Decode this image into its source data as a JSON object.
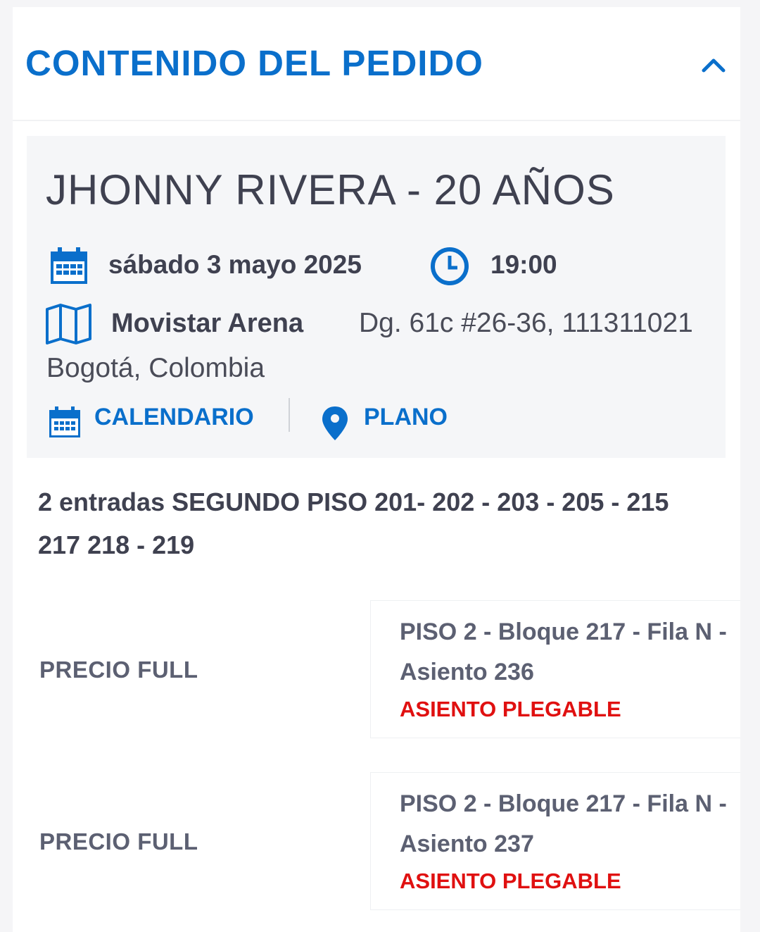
{
  "order": {
    "title": "CONTENIDO DEL PEDIDO"
  },
  "event": {
    "title": "JHONNY RIVERA - 20 AÑOS",
    "date": "sábado 3 mayo 2025",
    "time": "19:00",
    "venue_name": "Movistar Arena",
    "venue_address": "Dg. 61c #26-36, 111311021",
    "venue_city": "Bogotá, Colombia",
    "calendar_label": "CALENDARIO",
    "map_label": "PLANO"
  },
  "tickets": {
    "summary": "2 entradas SEGUNDO PISO 201- 202 - 203 - 205 - 215 217 218 - 219",
    "items": [
      {
        "price": "PRECIO FULL",
        "seat": "PISO 2 - Bloque 217 - Fila N - Asiento 236",
        "note": "ASIENTO PLEGABLE"
      },
      {
        "price": "PRECIO FULL",
        "seat": "PISO 2 - Bloque 217 - Fila N - Asiento 237",
        "note": "ASIENTO PLEGABLE"
      }
    ]
  },
  "colors": {
    "accent": "#0a6fcb",
    "warning": "#e01010",
    "text": "#3f4150",
    "muted": "#5c6072"
  },
  "icons": {
    "collapse": "chevron-up-icon",
    "date": "calendar-icon",
    "time": "clock-icon",
    "venue": "map-icon",
    "calendar_link": "calendar-icon",
    "map_link": "map-pin-icon"
  }
}
